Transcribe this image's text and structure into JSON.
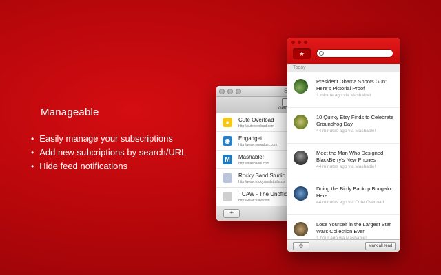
{
  "promo": {
    "title": "Manageable",
    "bullets": [
      "Easily manage your subscriptions",
      "Add new subcriptions by search/URL",
      "Hide feed notifications"
    ]
  },
  "subscriptions_window": {
    "title": "S",
    "toolbar_label": "Gen",
    "items": [
      {
        "name": "Cute Overload",
        "url": "http://cuteoverload.com",
        "icon": "duck-icon",
        "color": "#f5c518"
      },
      {
        "name": "Engadget",
        "url": "http://www.engadget.com",
        "icon": "rss-icon",
        "color": "#2a7fc9"
      },
      {
        "name": "Mashable!",
        "url": "http://mashable.com",
        "icon": "mashable-icon",
        "color": "#1f7bc0"
      },
      {
        "name": "Rocky Sand Studio » N",
        "url": "http://www.rockysandstudio.co",
        "icon": "rss-icon",
        "color": "#b9c3d9"
      },
      {
        "name": "TUAW - The Unofficial",
        "url": "http://www.tuaw.com",
        "icon": "tuaw-icon",
        "color": "#cfcfcf"
      }
    ],
    "add_label": "+"
  },
  "feed_window": {
    "star_label": "★",
    "search_placeholder": "",
    "section_label": "Today",
    "items": [
      {
        "title": "President Obama Shoots Gun: Here's Pictorial Proof",
        "meta": "1 minute ago via Mashable!",
        "thumb": "#3c6b2a"
      },
      {
        "title": "10 Quirky Etsy Finds to Celebrate Groundhog Day",
        "meta": "44 minutes ago via Mashable!",
        "thumb": "#7a8a2e"
      },
      {
        "title": "Meet the Man Who Designed BlackBerry's New Phones",
        "meta": "44 minutes ago via Mashable!",
        "thumb": "#444444"
      },
      {
        "title": "Doing the Birdy Backup Boogaloo Here",
        "meta": "44 minutes ago via Cute Overload",
        "thumb": "#2b4f7a"
      },
      {
        "title": "Lose Yourself in the Largest Star Wars Collection Ever",
        "meta": "1 hour ago via Mashable!",
        "thumb": "#6e5a3a"
      }
    ],
    "gear_label": "⚙",
    "mark_all_label": "Mark all read"
  }
}
